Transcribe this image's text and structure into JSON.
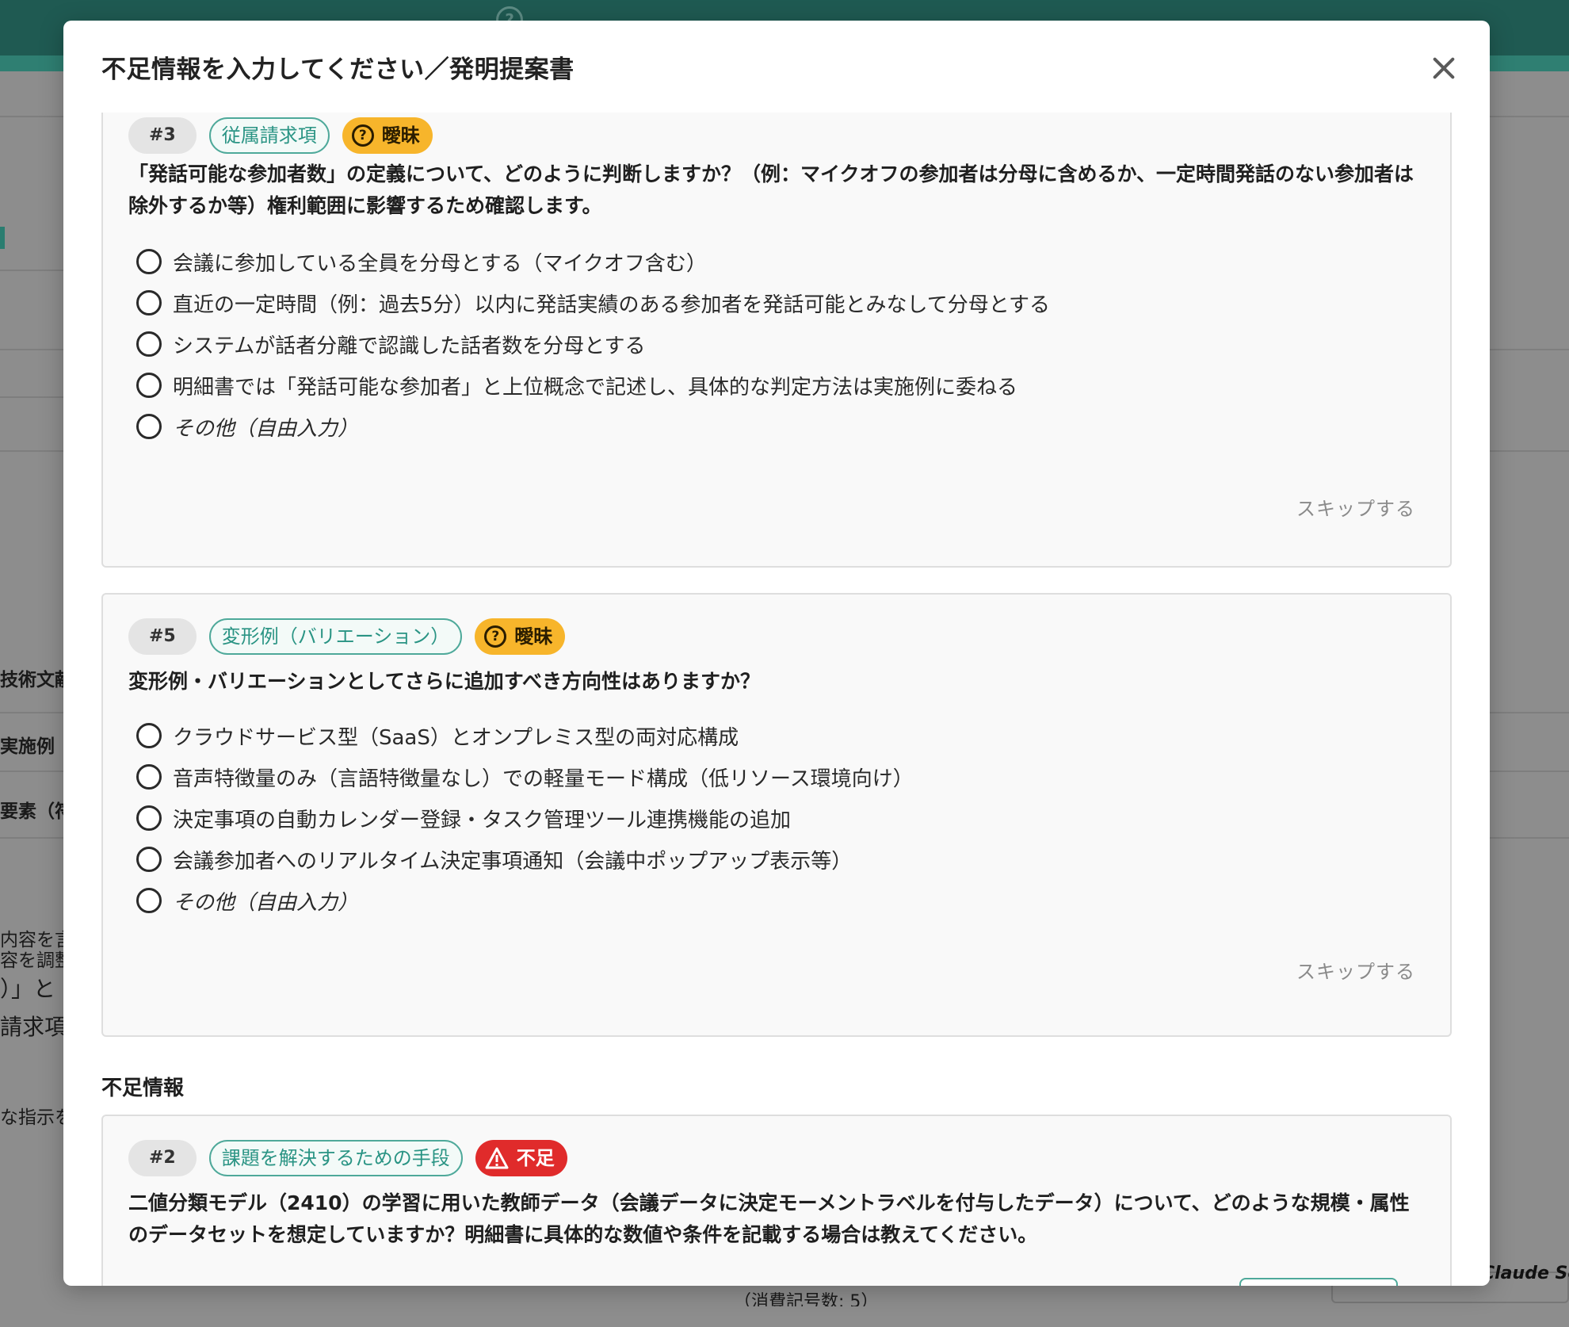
{
  "background": {
    "help_icon_glyph": "?",
    "snippets": [
      "技術文献",
      "実施例",
      "要素（符",
      "内容を言",
      "容を調整",
      "）」と",
      "請求項",
      "な指示を",
      "（消費記号数: 5）"
    ],
    "claude_label": "Claude So"
  },
  "modal": {
    "title": "不足情報を入力してください／発明提案書",
    "close_icon": "close-icon"
  },
  "ambiguous_questions": [
    {
      "number": "#3",
      "category": "従属請求項",
      "status": "曖昧",
      "status_icon": "question-circle-icon",
      "status_color": "#f7b52b",
      "question": "「発話可能な参加者数」の定義について、どのように判断しますか？（例：マイクオフの参加者は分母に含めるか、一定時間発話のない参加者は除外するか等）権利範囲に影響するため確認します。",
      "options": [
        "会議に参加している全員を分母とする（マイクオフ含む）",
        "直近の一定時間（例：過去5分）以内に発話実績のある参加者を発話可能とみなして分母とする",
        "システムが話者分離で認識した話者数を分母とする",
        "明細書では「発話可能な参加者」と上位概念で記述し、具体的な判定方法は実施例に委ねる",
        "その他（自由入力）"
      ],
      "skip_label": "スキップする"
    },
    {
      "number": "#5",
      "category": "変形例（バリエーション）",
      "status": "曖昧",
      "status_icon": "question-circle-icon",
      "status_color": "#f7b52b",
      "question": "変形例・バリエーションとしてさらに追加すべき方向性はありますか？",
      "options": [
        "クラウドサービス型（SaaS）とオンプレミス型の両対応構成",
        "音声特徴量のみ（言語特徴量なし）での軽量モード構成（低リソース環境向け）",
        "決定事項の自動カレンダー登録・タスク管理ツール連携機能の追加",
        "会議参加者へのリアルタイム決定事項通知（会議中ポップアップ表示等）",
        "その他（自由入力）"
      ],
      "skip_label": "スキップする"
    }
  ],
  "missing_section": {
    "title": "不足情報",
    "items": [
      {
        "number": "#2",
        "category": "課題を解決するための手段",
        "status": "不足",
        "status_icon": "warning-triangle-icon",
        "status_color": "#e02b2b",
        "question": "二値分類モデル（2410）の学習に用いた教師データ（会議データに決定モーメントラベルを付与したデータ）について、どのような規模・属性のデータセットを想定していますか？明細書に具体的な数値や条件を記載する場合は教えてください。"
      }
    ]
  }
}
